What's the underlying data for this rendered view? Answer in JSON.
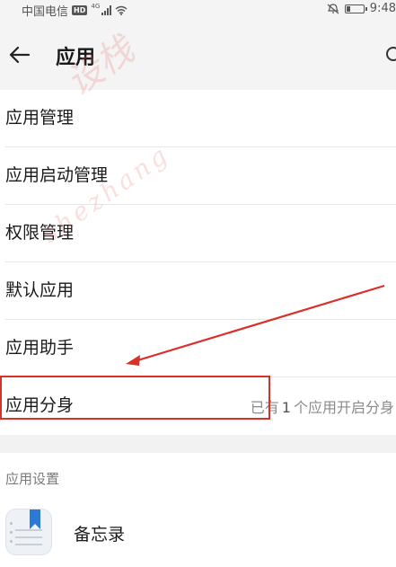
{
  "status_bar": {
    "carrier": "中国电信",
    "hd": "HD",
    "network": "4G",
    "time": "9:48"
  },
  "header": {
    "title": "应用",
    "back_icon": "arrow-left-icon",
    "search_icon": "search-icon"
  },
  "menu": {
    "items": [
      {
        "label": "应用管理"
      },
      {
        "label": "应用启动管理"
      },
      {
        "label": "权限管理"
      },
      {
        "label": "默认应用"
      },
      {
        "label": "应用助手"
      },
      {
        "label": "应用分身",
        "hint_prefix": "已有",
        "hint_count": "1",
        "hint_suffix": "个应用开启分身"
      }
    ]
  },
  "settings": {
    "section_title": "应用设置",
    "apps": [
      {
        "name": "备忘录",
        "icon": "notes-icon"
      }
    ]
  },
  "watermark": {
    "text": "shezhang",
    "text_cn": "设栈"
  },
  "annotation": {
    "color": "#d9302b"
  }
}
